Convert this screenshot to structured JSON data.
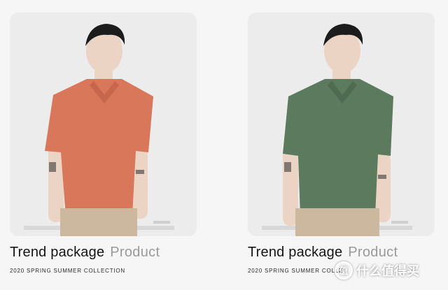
{
  "products": [
    {
      "title": "Trend package",
      "subtitle": "Product",
      "collection": "2020 SPRING SUMMER COLLECTION",
      "shirt_color": "#d9775b",
      "shirt_shade": "#c6664c"
    },
    {
      "title": "Trend package",
      "subtitle": "Product",
      "collection": "2020 SPRING SUMMER COLLEC",
      "shirt_color": "#5c7a5d",
      "shirt_shade": "#4e6a50"
    }
  ],
  "watermark": {
    "logo_glyph": "值",
    "text": "什么值得买"
  }
}
